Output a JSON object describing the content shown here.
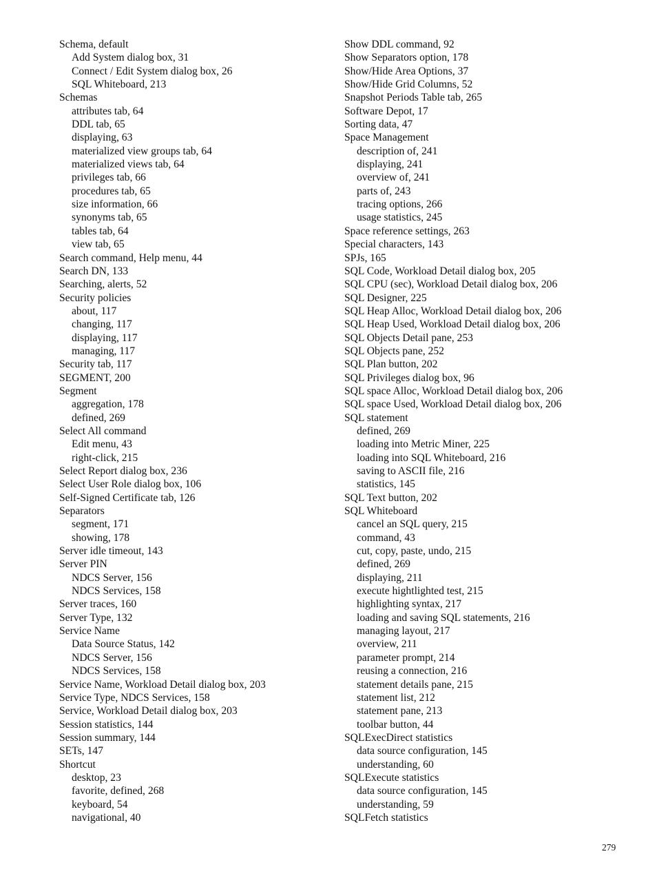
{
  "page": {
    "page_number": "279",
    "columns": [
      {
        "entries": [
          {
            "level": 1,
            "text": "Schema, default"
          },
          {
            "level": 2,
            "text": "Add System dialog box, 31"
          },
          {
            "level": 2,
            "text": "Connect / Edit System dialog box, 26"
          },
          {
            "level": 2,
            "text": "SQL Whiteboard, 213"
          },
          {
            "level": 1,
            "text": "Schemas"
          },
          {
            "level": 2,
            "text": "attributes tab, 64"
          },
          {
            "level": 2,
            "text": "DDL tab, 65"
          },
          {
            "level": 2,
            "text": "displaying, 63"
          },
          {
            "level": 2,
            "text": "materialized view groups tab, 64"
          },
          {
            "level": 2,
            "text": "materialized views tab, 64"
          },
          {
            "level": 2,
            "text": "privileges tab, 66"
          },
          {
            "level": 2,
            "text": "procedures tab, 65"
          },
          {
            "level": 2,
            "text": "size information, 66"
          },
          {
            "level": 2,
            "text": "synonyms tab, 65"
          },
          {
            "level": 2,
            "text": "tables tab, 64"
          },
          {
            "level": 2,
            "text": "view tab, 65"
          },
          {
            "level": 1,
            "text": "Search command, Help menu, 44"
          },
          {
            "level": 1,
            "text": "Search DN, 133"
          },
          {
            "level": 1,
            "text": "Searching, alerts, 52"
          },
          {
            "level": 1,
            "text": "Security policies"
          },
          {
            "level": 2,
            "text": "about, 117"
          },
          {
            "level": 2,
            "text": "changing, 117"
          },
          {
            "level": 2,
            "text": "displaying, 117"
          },
          {
            "level": 2,
            "text": "managing, 117"
          },
          {
            "level": 1,
            "text": "Security tab, 117"
          },
          {
            "level": 1,
            "text": "SEGMENT, 200"
          },
          {
            "level": 1,
            "text": "Segment"
          },
          {
            "level": 2,
            "text": "aggregation, 178"
          },
          {
            "level": 2,
            "text": "defined, 269"
          },
          {
            "level": 1,
            "text": "Select All command"
          },
          {
            "level": 2,
            "text": "Edit menu, 43"
          },
          {
            "level": 2,
            "text": "right-click, 215"
          },
          {
            "level": 1,
            "text": "Select Report dialog box, 236"
          },
          {
            "level": 1,
            "text": "Select User Role dialog box, 106"
          },
          {
            "level": 1,
            "text": "Self-Signed Certificate tab, 126"
          },
          {
            "level": 1,
            "text": "Separators"
          },
          {
            "level": 2,
            "text": "segment, 171"
          },
          {
            "level": 2,
            "text": "showing, 178"
          },
          {
            "level": 1,
            "text": "Server idle timeout, 143"
          },
          {
            "level": 1,
            "text": "Server PIN"
          },
          {
            "level": 2,
            "text": "NDCS Server, 156"
          },
          {
            "level": 2,
            "text": "NDCS Services, 158"
          },
          {
            "level": 1,
            "text": "Server traces, 160"
          },
          {
            "level": 1,
            "text": "Server Type, 132"
          },
          {
            "level": 1,
            "text": "Service Name"
          },
          {
            "level": 2,
            "text": "Data Source Status, 142"
          },
          {
            "level": 2,
            "text": "NDCS Server, 156"
          },
          {
            "level": 2,
            "text": "NDCS Services, 158"
          },
          {
            "level": 1,
            "text": "Service Name, Workload Detail dialog box, 203"
          },
          {
            "level": 1,
            "text": "Service Type, NDCS Services, 158"
          },
          {
            "level": 1,
            "text": "Service, Workload Detail dialog box, 203"
          },
          {
            "level": 1,
            "text": "Session statistics, 144"
          },
          {
            "level": 1,
            "text": "Session summary, 144"
          },
          {
            "level": 1,
            "text": "SETs, 147"
          },
          {
            "level": 1,
            "text": "Shortcut"
          },
          {
            "level": 2,
            "text": "desktop, 23"
          },
          {
            "level": 2,
            "text": "favorite, defined, 268"
          },
          {
            "level": 2,
            "text": "keyboard, 54"
          },
          {
            "level": 2,
            "text": "navigational, 40"
          }
        ]
      },
      {
        "entries": [
          {
            "level": 1,
            "text": "Show DDL command, 92"
          },
          {
            "level": 1,
            "text": "Show Separators option, 178"
          },
          {
            "level": 1,
            "text": "Show/Hide Area Options, 37"
          },
          {
            "level": 1,
            "text": "Show/Hide Grid Columns, 52"
          },
          {
            "level": 1,
            "text": "Snapshot Periods Table tab, 265"
          },
          {
            "level": 1,
            "text": "Software Depot, 17"
          },
          {
            "level": 1,
            "text": "Sorting data, 47"
          },
          {
            "level": 1,
            "text": "Space Management"
          },
          {
            "level": 2,
            "text": "description of, 241"
          },
          {
            "level": 2,
            "text": "displaying, 241"
          },
          {
            "level": 2,
            "text": "overview of, 241"
          },
          {
            "level": 2,
            "text": "parts of, 243"
          },
          {
            "level": 2,
            "text": "tracing options, 266"
          },
          {
            "level": 2,
            "text": "usage statistics, 245"
          },
          {
            "level": 1,
            "text": "Space reference settings, 263"
          },
          {
            "level": 1,
            "text": "Special characters, 143"
          },
          {
            "level": 1,
            "text": "SPJs, 165"
          },
          {
            "level": 1,
            "text": "SQL Code, Workload Detail dialog box, 205"
          },
          {
            "level": 1,
            "text": "SQL CPU (sec), Workload Detail dialog box, 206"
          },
          {
            "level": 1,
            "text": "SQL Designer, 225"
          },
          {
            "level": 1,
            "text": "SQL Heap Alloc, Workload Detail dialog box, 206"
          },
          {
            "level": 1,
            "text": "SQL Heap Used, Workload Detail dialog box, 206"
          },
          {
            "level": 1,
            "text": "SQL Objects Detail pane, 253"
          },
          {
            "level": 1,
            "text": "SQL Objects pane, 252"
          },
          {
            "level": 1,
            "text": "SQL Plan button, 202"
          },
          {
            "level": 1,
            "text": "SQL Privileges dialog box, 96"
          },
          {
            "level": 1,
            "text": "SQL space Alloc, Workload Detail dialog box, 206"
          },
          {
            "level": 1,
            "text": "SQL space Used, Workload Detail dialog box, 206"
          },
          {
            "level": 1,
            "text": "SQL statement"
          },
          {
            "level": 2,
            "text": "defined, 269"
          },
          {
            "level": 2,
            "text": "loading into Metric Miner, 225"
          },
          {
            "level": 2,
            "text": "loading into SQL Whiteboard, 216"
          },
          {
            "level": 2,
            "text": "saving to ASCII file, 216"
          },
          {
            "level": 2,
            "text": "statistics, 145"
          },
          {
            "level": 1,
            "text": "SQL Text button, 202"
          },
          {
            "level": 1,
            "text": "SQL Whiteboard"
          },
          {
            "level": 2,
            "text": "cancel an SQL query, 215"
          },
          {
            "level": 2,
            "text": "command, 43"
          },
          {
            "level": 2,
            "text": "cut, copy, paste, undo, 215"
          },
          {
            "level": 2,
            "text": "defined, 269"
          },
          {
            "level": 2,
            "text": "displaying, 211"
          },
          {
            "level": 2,
            "text": "execute hightlighted test, 215"
          },
          {
            "level": 2,
            "text": "highlighting syntax, 217"
          },
          {
            "level": 2,
            "text": "loading and saving SQL statements, 216"
          },
          {
            "level": 2,
            "text": "managing layout, 217"
          },
          {
            "level": 2,
            "text": "overview, 211"
          },
          {
            "level": 2,
            "text": "parameter prompt, 214"
          },
          {
            "level": 2,
            "text": "reusing a connection, 216"
          },
          {
            "level": 2,
            "text": "statement details pane, 215"
          },
          {
            "level": 2,
            "text": "statement list, 212"
          },
          {
            "level": 2,
            "text": "statement pane, 213"
          },
          {
            "level": 2,
            "text": "toolbar button, 44"
          },
          {
            "level": 1,
            "text": "SQLExecDirect statistics"
          },
          {
            "level": 2,
            "text": "data source configuration, 145"
          },
          {
            "level": 2,
            "text": "understanding, 60"
          },
          {
            "level": 1,
            "text": "SQLExecute statistics"
          },
          {
            "level": 2,
            "text": "data source configuration, 145"
          },
          {
            "level": 2,
            "text": "understanding, 59"
          },
          {
            "level": 1,
            "text": "SQLFetch statistics"
          }
        ]
      }
    ]
  }
}
